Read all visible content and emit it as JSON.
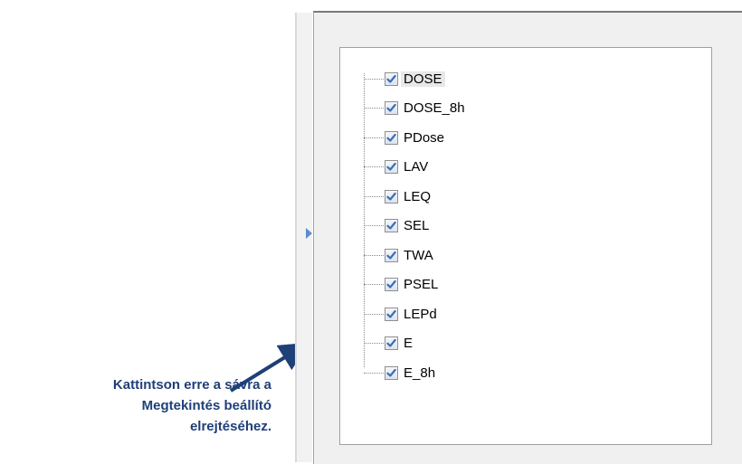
{
  "callout": {
    "text": "Kattintson erre a sávra a\nMegtekintés beállító\nelrejtéséhez."
  },
  "tree": {
    "items": [
      {
        "label": "DOSE",
        "checked": true,
        "selected": true
      },
      {
        "label": "DOSE_8h",
        "checked": true
      },
      {
        "label": "PDose",
        "checked": true
      },
      {
        "label": "LAV",
        "checked": true
      },
      {
        "label": "LEQ",
        "checked": true
      },
      {
        "label": "SEL",
        "checked": true
      },
      {
        "label": "TWA",
        "checked": true
      },
      {
        "label": "PSEL",
        "checked": true
      },
      {
        "label": "LEPd",
        "checked": true
      },
      {
        "label": "E",
        "checked": true
      },
      {
        "label": "E_8h",
        "checked": true
      }
    ]
  },
  "colors": {
    "callout_text": "#1f3f78",
    "arrow": "#1f3f78",
    "toggle_arrow": "#5a8fcf",
    "check_mark": "#3b6fb6"
  },
  "icons": {
    "splitter_toggle": "triangle-right-icon",
    "check": "checkmark-icon"
  }
}
